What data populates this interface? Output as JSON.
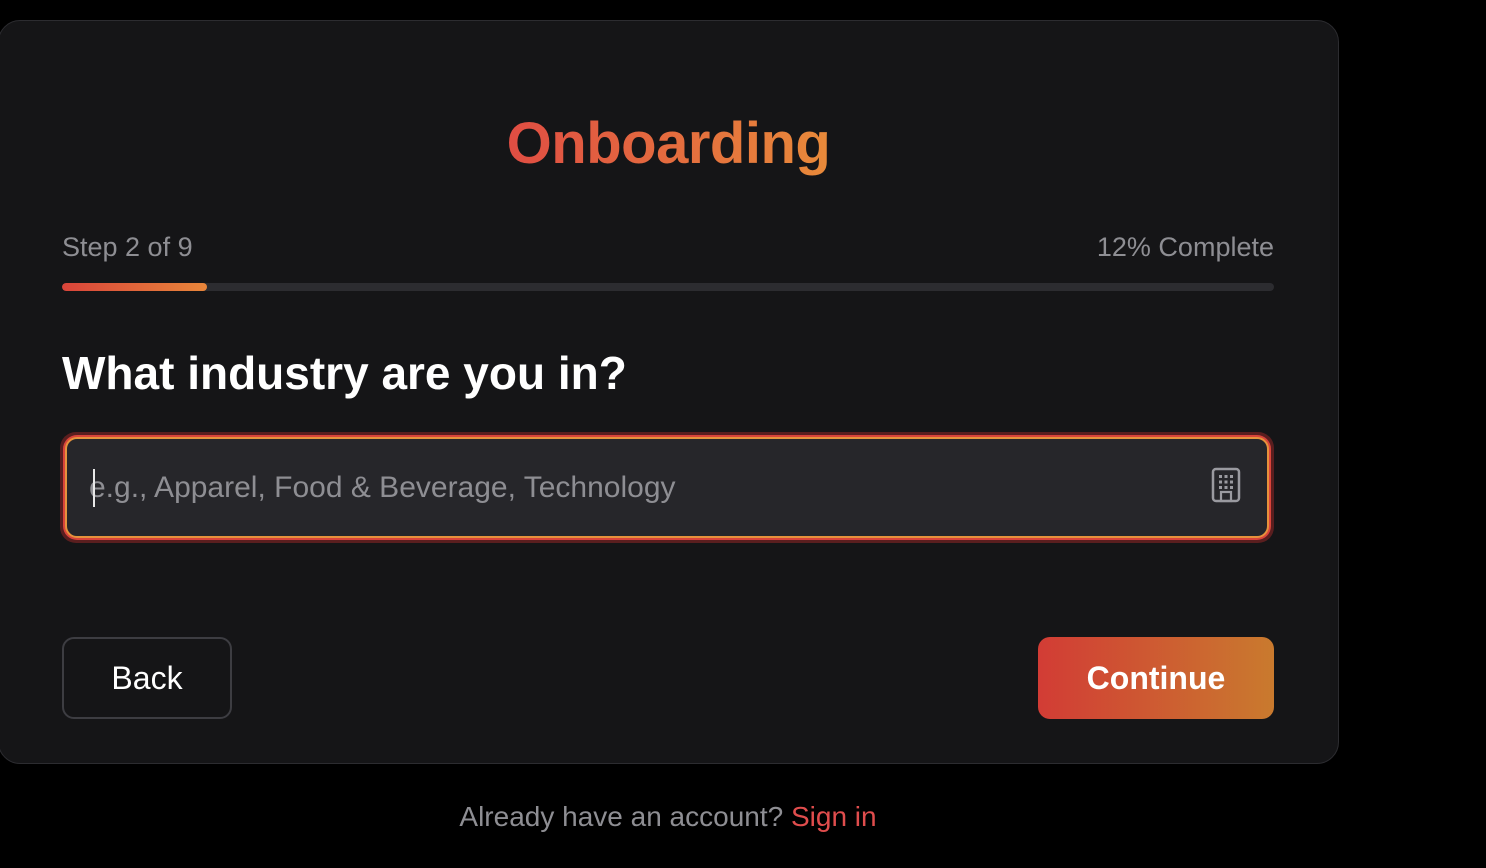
{
  "header": {
    "title": "Onboarding"
  },
  "progress": {
    "step_label": "Step 2 of 9",
    "percent_label": "12% Complete",
    "fraction": 0.12
  },
  "question": {
    "text": "What industry are you in?"
  },
  "industry_input": {
    "value": "",
    "placeholder": "e.g., Apparel, Food & Beverage, Technology",
    "icon": "building-icon"
  },
  "actions": {
    "back_label": "Back",
    "continue_label": "Continue"
  },
  "footer": {
    "prompt": "Already have an account?",
    "link_label": "Sign in"
  },
  "colors": {
    "accent_start": "#e04d43",
    "accent_end": "#e88a3a",
    "background": "#000000",
    "card": "#151517"
  }
}
